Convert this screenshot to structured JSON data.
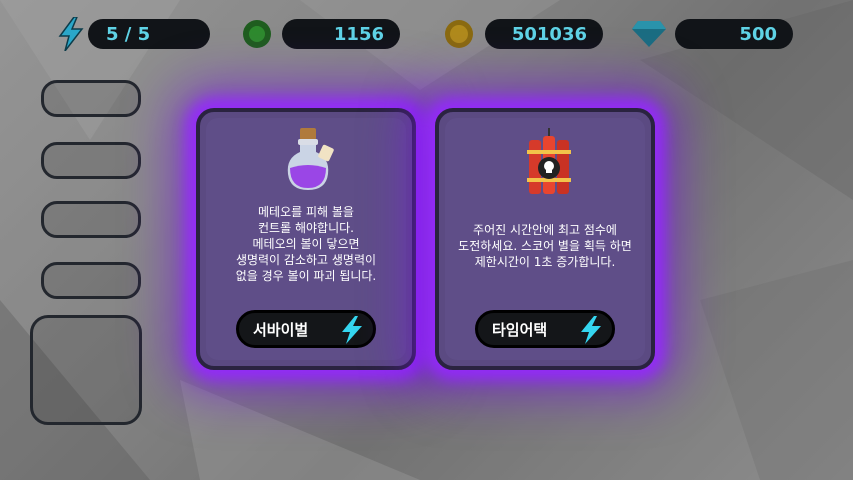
{
  "hud": {
    "energy": "5 / 5",
    "green_gems": "1156",
    "gold_coins": "501036",
    "diamonds": "500"
  },
  "icons": {
    "energy": "lightning-bolt-icon",
    "green": "green-gem-icon",
    "gold": "gold-coin-icon",
    "diamond": "diamond-icon"
  },
  "colors": {
    "glow": "#8e2cff",
    "card": "#5b4a82",
    "hud_text": "#5fd3e6",
    "bolt": "#35d6f0"
  },
  "modes": [
    {
      "description": "메테오를 피해 볼을\n컨트롤 해야합니다.\n메테오의 볼이 닿으면\n생명력이 감소하고 생명력이\n없을 경우 볼이 파괴 됩니다.",
      "button_label": "서바이벌"
    },
    {
      "description": "주어진 시간안에 최고 점수에\n도전하세요. 스코어 별을 획득 하면\n제한시간이 1초 증가합니다.",
      "button_label": "타임어택"
    }
  ]
}
